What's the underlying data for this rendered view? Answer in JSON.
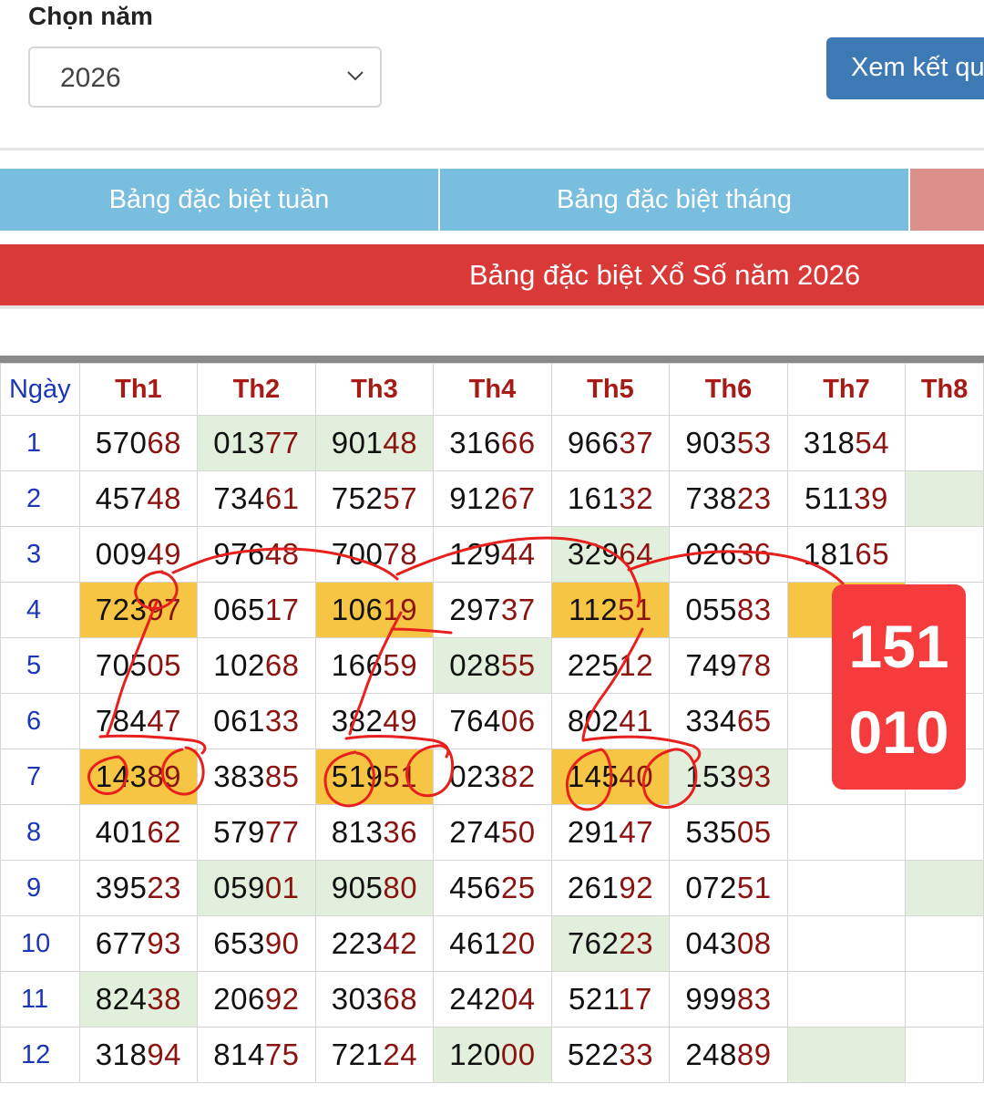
{
  "form": {
    "year_label": "Chọn năm",
    "year_value": "2026",
    "view_button": "Xem kết quả"
  },
  "tabs": [
    "Bảng đặc biệt tuần",
    "Bảng đặc biệt tháng",
    ""
  ],
  "banner": "Bảng đặc biệt Xổ Số năm 2026",
  "table": {
    "headers": [
      "Ngày",
      "Th1",
      "Th2",
      "Th3",
      "Th4",
      "Th5",
      "Th6",
      "Th7",
      "Th8"
    ],
    "rows": [
      {
        "day": "1",
        "cells": [
          {
            "h": "570",
            "t": "68"
          },
          {
            "h": "013",
            "t": "77"
          },
          {
            "h": "901",
            "t": "48"
          },
          {
            "h": "316",
            "t": "66"
          },
          {
            "h": "966",
            "t": "37"
          },
          {
            "h": "903",
            "t": "53"
          },
          {
            "h": "318",
            "t": "54"
          },
          {
            "h": "",
            "t": ""
          }
        ]
      },
      {
        "day": "2",
        "cells": [
          {
            "h": "457",
            "t": "48"
          },
          {
            "h": "734",
            "t": "61"
          },
          {
            "h": "752",
            "t": "57"
          },
          {
            "h": "912",
            "t": "67"
          },
          {
            "h": "161",
            "t": "32"
          },
          {
            "h": "738",
            "t": "23"
          },
          {
            "h": "511",
            "t": "39"
          },
          {
            "h": "",
            "t": ""
          }
        ]
      },
      {
        "day": "3",
        "cells": [
          {
            "h": "009",
            "t": "49"
          },
          {
            "h": "976",
            "t": "48"
          },
          {
            "h": "700",
            "t": "78"
          },
          {
            "h": "129",
            "t": "44"
          },
          {
            "h": "329",
            "t": "64"
          },
          {
            "h": "026",
            "t": "36"
          },
          {
            "h": "181",
            "t": "65"
          },
          {
            "h": "",
            "t": ""
          }
        ]
      },
      {
        "day": "4",
        "cells": [
          {
            "h": "723",
            "t": "97"
          },
          {
            "h": "065",
            "t": "17"
          },
          {
            "h": "106",
            "t": "19"
          },
          {
            "h": "297",
            "t": "37"
          },
          {
            "h": "112",
            "t": "51"
          },
          {
            "h": "055",
            "t": "83"
          },
          {
            "h": "",
            "t": ""
          },
          {
            "h": "",
            "t": ""
          }
        ]
      },
      {
        "day": "5",
        "cells": [
          {
            "h": "705",
            "t": "05"
          },
          {
            "h": "102",
            "t": "68"
          },
          {
            "h": "166",
            "t": "59"
          },
          {
            "h": "028",
            "t": "55"
          },
          {
            "h": "225",
            "t": "12"
          },
          {
            "h": "749",
            "t": "78"
          },
          {
            "h": "",
            "t": ""
          },
          {
            "h": "",
            "t": ""
          }
        ]
      },
      {
        "day": "6",
        "cells": [
          {
            "h": "784",
            "t": "47"
          },
          {
            "h": "061",
            "t": "33"
          },
          {
            "h": "382",
            "t": "49"
          },
          {
            "h": "764",
            "t": "06"
          },
          {
            "h": "802",
            "t": "41"
          },
          {
            "h": "334",
            "t": "65"
          },
          {
            "h": "",
            "t": ""
          },
          {
            "h": "",
            "t": ""
          }
        ]
      },
      {
        "day": "7",
        "cells": [
          {
            "h": "143",
            "t": "89"
          },
          {
            "h": "383",
            "t": "85"
          },
          {
            "h": "519",
            "t": "51"
          },
          {
            "h": "023",
            "t": "82"
          },
          {
            "h": "145",
            "t": "40"
          },
          {
            "h": "153",
            "t": "93"
          },
          {
            "h": "",
            "t": ""
          },
          {
            "h": "",
            "t": ""
          }
        ]
      },
      {
        "day": "8",
        "cells": [
          {
            "h": "401",
            "t": "62"
          },
          {
            "h": "579",
            "t": "77"
          },
          {
            "h": "813",
            "t": "36"
          },
          {
            "h": "274",
            "t": "50"
          },
          {
            "h": "291",
            "t": "47"
          },
          {
            "h": "535",
            "t": "05"
          },
          {
            "h": "",
            "t": ""
          },
          {
            "h": "",
            "t": ""
          }
        ]
      },
      {
        "day": "9",
        "cells": [
          {
            "h": "395",
            "t": "23"
          },
          {
            "h": "059",
            "t": "01"
          },
          {
            "h": "905",
            "t": "80"
          },
          {
            "h": "456",
            "t": "25"
          },
          {
            "h": "261",
            "t": "92"
          },
          {
            "h": "072",
            "t": "51"
          },
          {
            "h": "",
            "t": ""
          },
          {
            "h": "",
            "t": ""
          }
        ]
      },
      {
        "day": "10",
        "cells": [
          {
            "h": "677",
            "t": "93"
          },
          {
            "h": "653",
            "t": "90"
          },
          {
            "h": "223",
            "t": "42"
          },
          {
            "h": "461",
            "t": "20"
          },
          {
            "h": "762",
            "t": "23"
          },
          {
            "h": "043",
            "t": "08"
          },
          {
            "h": "",
            "t": ""
          },
          {
            "h": "",
            "t": ""
          }
        ]
      },
      {
        "day": "11",
        "cells": [
          {
            "h": "824",
            "t": "38"
          },
          {
            "h": "206",
            "t": "92"
          },
          {
            "h": "303",
            "t": "68"
          },
          {
            "h": "242",
            "t": "04"
          },
          {
            "h": "521",
            "t": "17"
          },
          {
            "h": "999",
            "t": "83"
          },
          {
            "h": "",
            "t": ""
          },
          {
            "h": "",
            "t": ""
          }
        ]
      },
      {
        "day": "12",
        "cells": [
          {
            "h": "318",
            "t": "94"
          },
          {
            "h": "814",
            "t": "75"
          },
          {
            "h": "721",
            "t": "24"
          },
          {
            "h": "120",
            "t": "00"
          },
          {
            "h": "522",
            "t": "33"
          },
          {
            "h": "248",
            "t": "89"
          },
          {
            "h": "",
            "t": ""
          },
          {
            "h": "",
            "t": ""
          }
        ]
      }
    ],
    "highlights": {
      "green": [
        "0-1",
        "0-2",
        "2-4",
        "4-3",
        "8-1",
        "8-2",
        "10-0",
        "9-4",
        "11-3",
        "6-5",
        "1-7",
        "11-6",
        "8-7"
      ],
      "orange": [
        "3-0",
        "3-2",
        "3-4",
        "3-6",
        "6-0",
        "6-2",
        "6-4"
      ]
    }
  },
  "annotation_badge": {
    "line1": "151",
    "line2": "010"
  },
  "colors": {
    "tail_digits": "#8b1411",
    "header": "#a61b16",
    "day": "#1b37b8",
    "ink": "#e8201d"
  }
}
